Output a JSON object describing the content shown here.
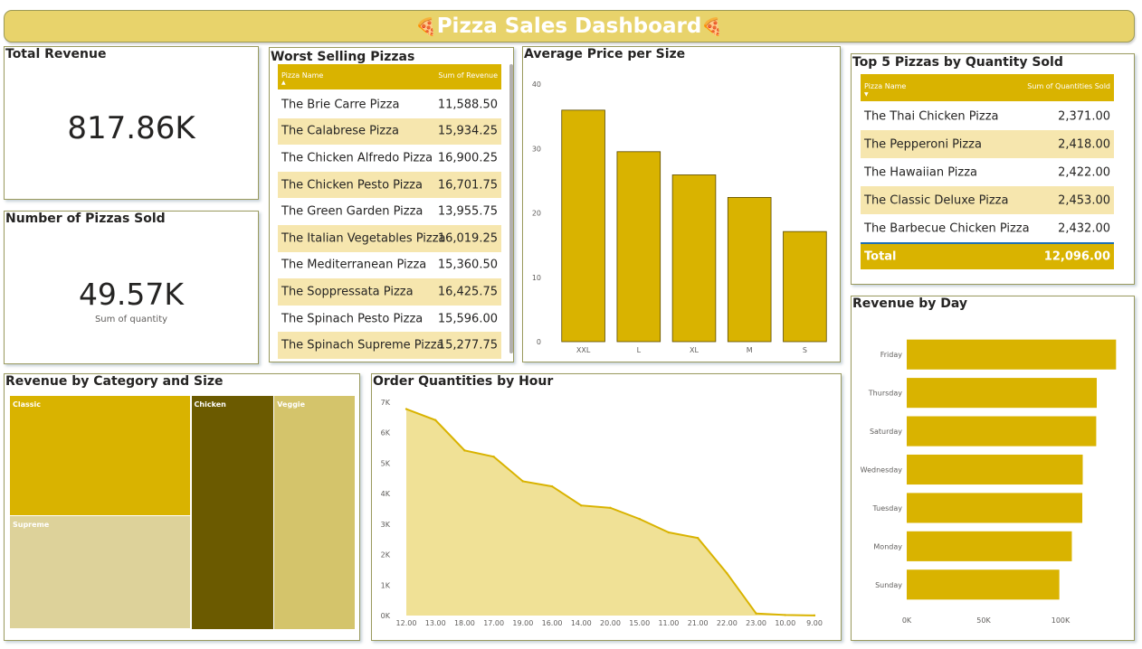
{
  "header": {
    "title": "Pizza Sales Dashboard",
    "icon_left": "🍕",
    "icon_right": "🍕"
  },
  "kpis": {
    "total_revenue": {
      "title": "Total Revenue",
      "value": "817.86K"
    },
    "pizzas_sold": {
      "title": "Number of Pizzas Sold",
      "value": "49.57K",
      "subtitle": "Sum of quantity"
    }
  },
  "worst_selling": {
    "title": "Worst Selling Pizzas",
    "columns": [
      "Pizza Name",
      "Sum of Revenue"
    ],
    "rows": [
      {
        "name": "The Brie Carre Pizza",
        "value": "11,588.50"
      },
      {
        "name": "The Calabrese Pizza",
        "value": "15,934.25"
      },
      {
        "name": "The Chicken Alfredo Pizza",
        "value": "16,900.25"
      },
      {
        "name": "The Chicken Pesto Pizza",
        "value": "16,701.75"
      },
      {
        "name": "The Green Garden Pizza",
        "value": "13,955.75"
      },
      {
        "name": "The Italian Vegetables Pizza",
        "value": "16,019.25"
      },
      {
        "name": "The Mediterranean Pizza",
        "value": "15,360.50"
      },
      {
        "name": "The Soppressata Pizza",
        "value": "16,425.75"
      },
      {
        "name": "The Spinach Pesto Pizza",
        "value": "15,596.00"
      },
      {
        "name": "The Spinach Supreme Pizza",
        "value": "15,277.75"
      }
    ]
  },
  "top5": {
    "title": "Top 5 Pizzas by Quantity Sold",
    "columns": [
      "Pizza Name",
      "Sum of Quantities Sold"
    ],
    "rows": [
      {
        "name": "The Thai Chicken Pizza",
        "value": "2,371.00"
      },
      {
        "name": "The Pepperoni Pizza",
        "value": "2,418.00"
      },
      {
        "name": "The Hawaiian Pizza",
        "value": "2,422.00"
      },
      {
        "name": "The Classic Deluxe Pizza",
        "value": "2,453.00"
      },
      {
        "name": "The Barbecue Chicken Pizza",
        "value": "2,432.00"
      }
    ],
    "total_label": "Total",
    "total_value": "12,096.00"
  },
  "colors": {
    "gold": "#d9b300",
    "dark_gold": "#6b5a00",
    "light_gold": "#f0e196",
    "pale_gold": "#ddd29a",
    "mid_gold": "#d4c46b"
  },
  "chart_data": [
    {
      "id": "avg_price",
      "type": "bar",
      "title": "Average Price per Size",
      "categories": [
        "XXL",
        "L",
        "XL",
        "M",
        "S"
      ],
      "values": [
        35.95,
        29.5,
        25.9,
        22.4,
        17.1
      ],
      "ylim": [
        0,
        40
      ],
      "yticks": [
        "0",
        "10",
        "20",
        "30",
        "40"
      ]
    },
    {
      "id": "revenue_by_day",
      "type": "bar",
      "orientation": "horizontal",
      "title": "Revenue by Day",
      "categories": [
        "Friday",
        "Thursday",
        "Saturday",
        "Wednesday",
        "Tuesday",
        "Monday",
        "Sunday"
      ],
      "values": [
        136073,
        123529,
        123182,
        114408,
        114133,
        107330,
        99203
      ],
      "xlim": [
        0,
        150000
      ],
      "xticks": [
        "0K",
        "50K",
        "100K"
      ]
    },
    {
      "id": "order_qty_by_hour",
      "type": "area",
      "title": "Order Quantities by Hour",
      "categories": [
        "12.00",
        "13.00",
        "18.00",
        "17.00",
        "19.00",
        "16.00",
        "14.00",
        "20.00",
        "15.00",
        "11.00",
        "21.00",
        "22.00",
        "23.00",
        "10.00",
        "9.00"
      ],
      "values": [
        6776,
        6413,
        5417,
        5211,
        4406,
        4239,
        3613,
        3534,
        3170,
        2728,
        2545,
        1386,
        68,
        18,
        4
      ],
      "ylim": [
        0,
        7000
      ],
      "yticks": [
        "0K",
        "1K",
        "2K",
        "3K",
        "4K",
        "5K",
        "6K",
        "7K"
      ]
    },
    {
      "id": "revenue_by_category",
      "type": "treemap",
      "title": "Revenue by Category and Size",
      "items": [
        {
          "name": "Classic",
          "value": 220053
        },
        {
          "name": "Supreme",
          "value": 208197
        },
        {
          "name": "Chicken",
          "value": 195920
        },
        {
          "name": "Veggie",
          "value": 193690
        }
      ]
    }
  ]
}
